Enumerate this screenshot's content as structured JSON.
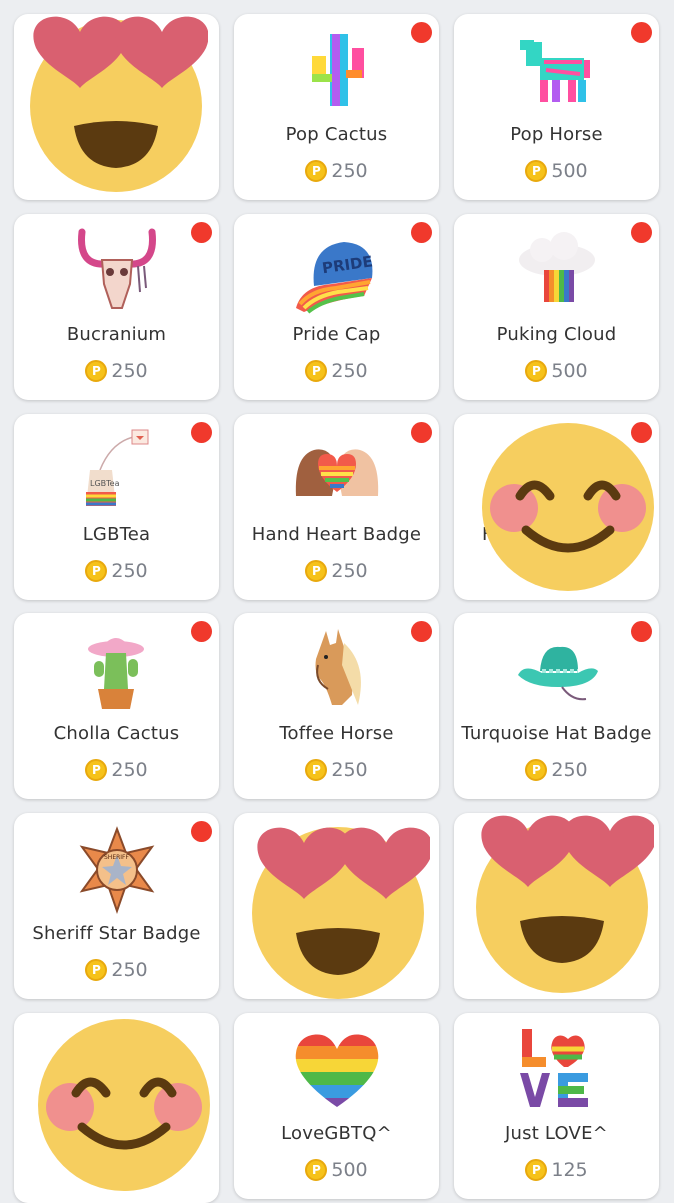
{
  "items": [
    {
      "name": "",
      "price": "",
      "art": "heart-eyes-emoji",
      "badge": false
    },
    {
      "name": "Pop Cactus",
      "price": "250",
      "art": "pop-cactus-icon",
      "badge": true
    },
    {
      "name": "Pop Horse",
      "price": "500",
      "art": "pop-horse-icon",
      "badge": true
    },
    {
      "name": "Bucranium",
      "price": "250",
      "art": "bucranium-icon",
      "badge": true
    },
    {
      "name": "Pride Cap",
      "price": "250",
      "art": "pride-cap-icon",
      "badge": true
    },
    {
      "name": "Puking Cloud",
      "price": "500",
      "art": "puking-cloud-icon",
      "badge": true
    },
    {
      "name": "LGBTea",
      "price": "250",
      "art": "lgbtea-icon",
      "badge": true
    },
    {
      "name": "Hand Heart Badge",
      "price": "250",
      "art": "hand-heart-icon",
      "badge": true
    },
    {
      "name": "",
      "price": "",
      "art": "smiling-blush-emoji",
      "badge": true
    },
    {
      "name": "Cholla Cactus",
      "price": "250",
      "art": "cholla-cactus-icon",
      "badge": true
    },
    {
      "name": "Toffee Horse",
      "price": "250",
      "art": "toffee-horse-icon",
      "badge": true
    },
    {
      "name": "Turquoise Hat Badge",
      "price": "250",
      "art": "turquoise-hat-icon",
      "badge": true
    },
    {
      "name": "Sheriff Star Badge",
      "price": "250",
      "art": "sheriff-star-icon",
      "badge": true
    },
    {
      "name": "",
      "price": "",
      "art": "heart-eyes-emoji",
      "badge": false
    },
    {
      "name": "",
      "price": "",
      "art": "heart-eyes-emoji",
      "badge": false
    },
    {
      "name": "",
      "price": "",
      "art": "smiling-blush-emoji",
      "badge": false
    },
    {
      "name": "LoveGBTQ^",
      "price": "500",
      "art": "rainbow-heart-icon",
      "badge": false
    },
    {
      "name": "Just LOVE^",
      "price": "125",
      "art": "love-letters-icon",
      "badge": false
    }
  ],
  "partial_label": "H",
  "coin_symbol": "P",
  "colors": {
    "badge": "#f0392c",
    "coin": "#f6c21a",
    "emoji": "#f6ce5f",
    "heart": "#d96070"
  }
}
